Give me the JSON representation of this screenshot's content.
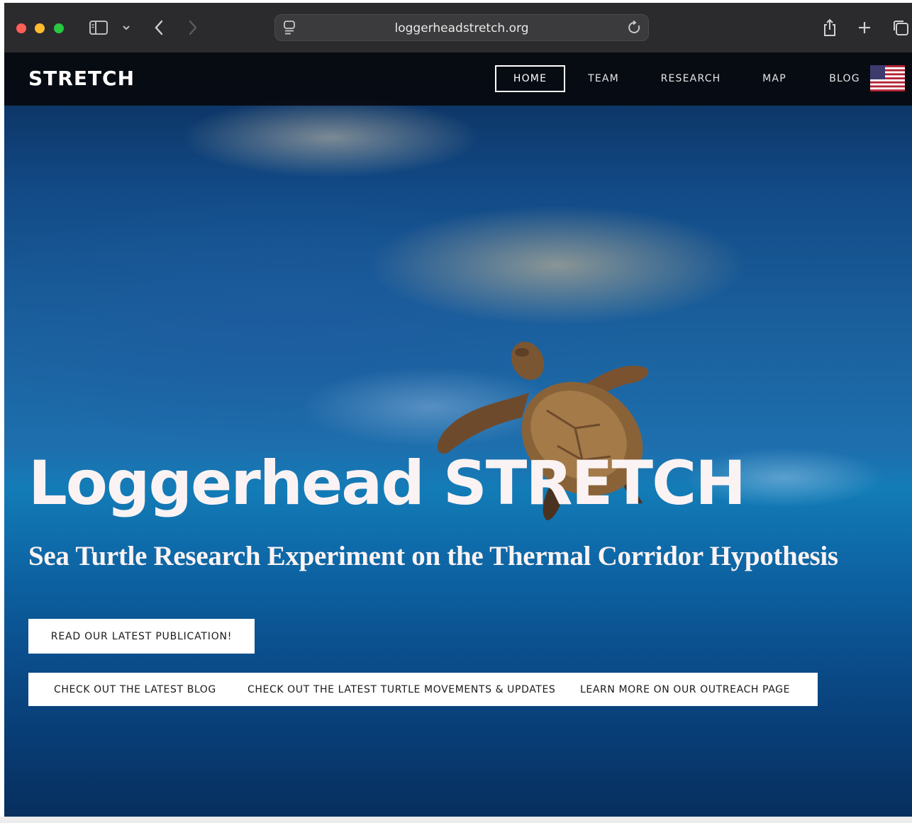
{
  "browser": {
    "url": "loggerheadstretch.org",
    "icons": [
      "sidebar-icon",
      "chevron-down-icon",
      "back-icon",
      "forward-icon",
      "site-settings-icon",
      "reload-icon",
      "share-icon",
      "new-tab-icon",
      "tabs-icon"
    ]
  },
  "site": {
    "brand": "STRETCH",
    "nav": [
      {
        "label": "HOME",
        "active": true
      },
      {
        "label": "TEAM",
        "active": false
      },
      {
        "label": "RESEARCH",
        "active": false
      },
      {
        "label": "MAP",
        "active": false
      },
      {
        "label": "BLOG",
        "active": false
      }
    ],
    "language_flag": "us-flag-icon"
  },
  "hero": {
    "title": "Loggerhead STRETCH",
    "subtitle": "Sea Turtle Research Experiment on the Thermal Corridor Hypothesis",
    "primary_button": "READ OUR LATEST PUBLICATION!",
    "links": [
      "CHECK OUT THE LATEST BLOG",
      "CHECK OUT THE LATEST TURTLE MOVEMENTS & UPDATES",
      "LEARN MORE ON OUR OUTREACH PAGE"
    ]
  },
  "colors": {
    "nav_bg": "#08090e",
    "ocean_light": "#137cb7",
    "ocean_deep": "#072f5e",
    "title_text": "#fbf3f3"
  }
}
